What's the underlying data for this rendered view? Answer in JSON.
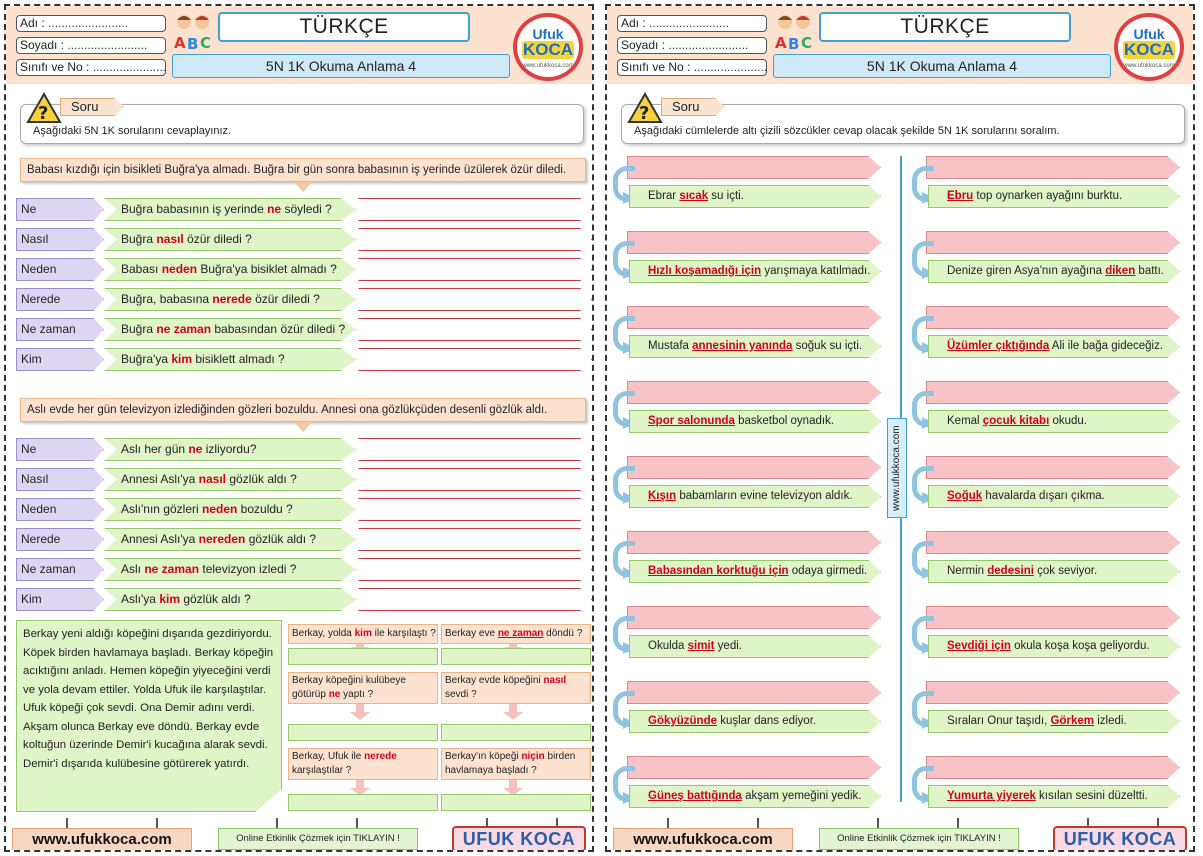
{
  "header": {
    "adi": "Adı :",
    "soyadi": "Soyadı :",
    "sinifi": "Sınıfı ve No :",
    "dots": "........................",
    "title": "TÜRKÇE",
    "subtitle": "5N 1K Okuma Anlama 4",
    "logo_line1": "Ufuk",
    "logo_line2": "KOCA",
    "logo_line3": "www.ufukkoca.com"
  },
  "soru_label": "Soru",
  "page1": {
    "instruction": "Aşağıdaki 5N 1K sorularını cevaplayınız.",
    "para1": "Babası kızdığı için bisikleti Buğra'ya almadı. Buğra bir gün sonra babasının iş yerinde üzülerek özür diledi.",
    "q1": [
      {
        "w": "Ne",
        "pre": "Buğra babasının iş yerinde ",
        "key": "ne",
        "post": " söyledi ?"
      },
      {
        "w": "Nasıl",
        "pre": "Buğra ",
        "key": "nasıl",
        "post": " özür diledi ?"
      },
      {
        "w": "Neden",
        "pre": "Babası ",
        "key": "neden",
        "post": " Buğra'ya bisiklet almadı ?"
      },
      {
        "w": "Nerede",
        "pre": "Buğra, babasına ",
        "key": "nerede",
        "post": " özür diledi ?"
      },
      {
        "w": "Ne zaman",
        "pre": "Buğra ",
        "key": "ne zaman",
        "post": "  babasından özür diledi ?"
      },
      {
        "w": "Kim",
        "pre": "Buğra'ya ",
        "key": "kim",
        "post": " bisiklett almadı ?"
      }
    ],
    "para2": "Aslı evde her gün televizyon izlediğinden gözleri bozuldu. Annesi ona gözlükçüden desenli gözlük aldı.",
    "q2": [
      {
        "w": "Ne",
        "pre": "Aslı her gün ",
        "key": "ne",
        "post": " izliyordu?"
      },
      {
        "w": "Nasıl",
        "pre": "Annesi Aslı'ya ",
        "key": "nasıl",
        "post": " gözlük aldı ?"
      },
      {
        "w": "Neden",
        "pre": "Aslı'nın gözleri ",
        "key": "neden",
        "post": " bozuldu ?"
      },
      {
        "w": "Nerede",
        "pre": "Annesi Aslı'ya ",
        "key": "nereden",
        "post": " gözlük aldı ?"
      },
      {
        "w": "Ne zaman",
        "pre": "Aslı ",
        "key": "ne zaman",
        "post": "   televizyon izledi ?"
      },
      {
        "w": "Kim",
        "pre": "Aslı'ya ",
        "key": "kim",
        "post": " gözlük aldı ?"
      }
    ],
    "story": "Berkay yeni aldığı köpeğini dışarıda gezdiriyordu. Köpek birden havlamaya başladı. Berkay köpeğin acıktığını anladı. Hemen köpeğin yiyeceğini verdi ve yola devam ettiler. Yolda Ufuk ile karşılaştılar. Ufuk köpeği çok sevdi. Ona Demir adını verdi. Akşam olunca Berkay eve döndü. Berkay evde koltuğun üzerinde Demir'i kucağına alarak sevdi. Demir'i dışarıda kulübesine götürerek yatırdı.",
    "mini": [
      {
        "pre": "Berkay, yolda ",
        "key": "kim",
        "post": " ile karşılaştı ?"
      },
      {
        "pre": "Berkay eve ",
        "key": "ne zaman",
        "post": " döndü ?"
      },
      {
        "pre": "Berkay köpeğini kulübeye götürüp ",
        "key": "ne",
        "post": " yaptı ?"
      },
      {
        "pre": "Berkay evde köpeğini ",
        "key": "nasıl",
        "post": " sevdi ?"
      },
      {
        "pre": "Berkay, Ufuk ile ",
        "key": "nerede",
        "post": " karşılaştılar ?"
      },
      {
        "pre": "Berkay'ın köpeği ",
        "key": "niçin",
        "post": " birden havlamaya başladı ?"
      }
    ]
  },
  "page2": {
    "instruction": "Aşağıdaki cümlelerde altı çizili sözcükler cevap olacak şekilde 5N 1K sorularını soralım.",
    "left": [
      {
        "pre": "Ebrar ",
        "key": "sıcak",
        "post": " su içti."
      },
      {
        "pre": "",
        "key": "Hızlı koşamadığı için",
        "post": " yarışmaya katılmadı."
      },
      {
        "pre": "Mustafa ",
        "key": "annesinin yanında",
        "post": " soğuk su içti."
      },
      {
        "pre": "",
        "key": "Spor salonunda",
        "post": " basketbol oynadık."
      },
      {
        "pre": "",
        "key": "Kışın",
        "post": " babamların evine televizyon aldık."
      },
      {
        "pre": "",
        "key": "Babasından korktuğu için",
        "post": " odaya girmedi."
      },
      {
        "pre": "Okulda ",
        "key": "simit",
        "post": " yedi."
      },
      {
        "pre": "",
        "key": "Gökyüzünde",
        "post": " kuşlar dans ediyor."
      },
      {
        "pre": "",
        "key": "Güneş battığında",
        "post": " akşam yemeğini yedik."
      }
    ],
    "right": [
      {
        "pre": "",
        "key": "Ebru",
        "post": " top oynarken ayağını burktu."
      },
      {
        "pre": "Denize giren Asya'nın ayağına ",
        "key": "diken",
        "post": " battı."
      },
      {
        "pre": "",
        "key": "Üzümler çıktığında",
        "post": " Ali ile bağa gideceğiz."
      },
      {
        "pre": "Kemal ",
        "key": "çocuk kitabı",
        "post": " okudu."
      },
      {
        "pre": "",
        "key": "Soğuk",
        "post": " havalarda dışarı çıkma."
      },
      {
        "pre": "Nermin ",
        "key": "dedesini",
        "post": " çok seviyor."
      },
      {
        "pre": "",
        "key": "Sevdiği için",
        "post": " okula koşa koşa geliyordu."
      },
      {
        "pre": "Sıraları Onur taşıdı, ",
        "key": "Görkem",
        "post": " izledi."
      },
      {
        "pre": "",
        "key": "Yumurta yiyerek",
        "post": " kısılan sesini düzeltti."
      }
    ],
    "vertical_url": "www.ufukkoca.com"
  },
  "footer": {
    "url": "www.ufukkoca.com",
    "online": "Online Etkinlik Çözmek için TIKLAYIN !",
    "brand": "UFUK KOCA"
  },
  "colors": {
    "accent_blue": "#3fa0d8",
    "red_keyword": "#d4001a",
    "peach": "#fde3cf",
    "green": "#dff5c8",
    "lavender": "#ddd6f3",
    "pink": "#f8c3c6"
  }
}
